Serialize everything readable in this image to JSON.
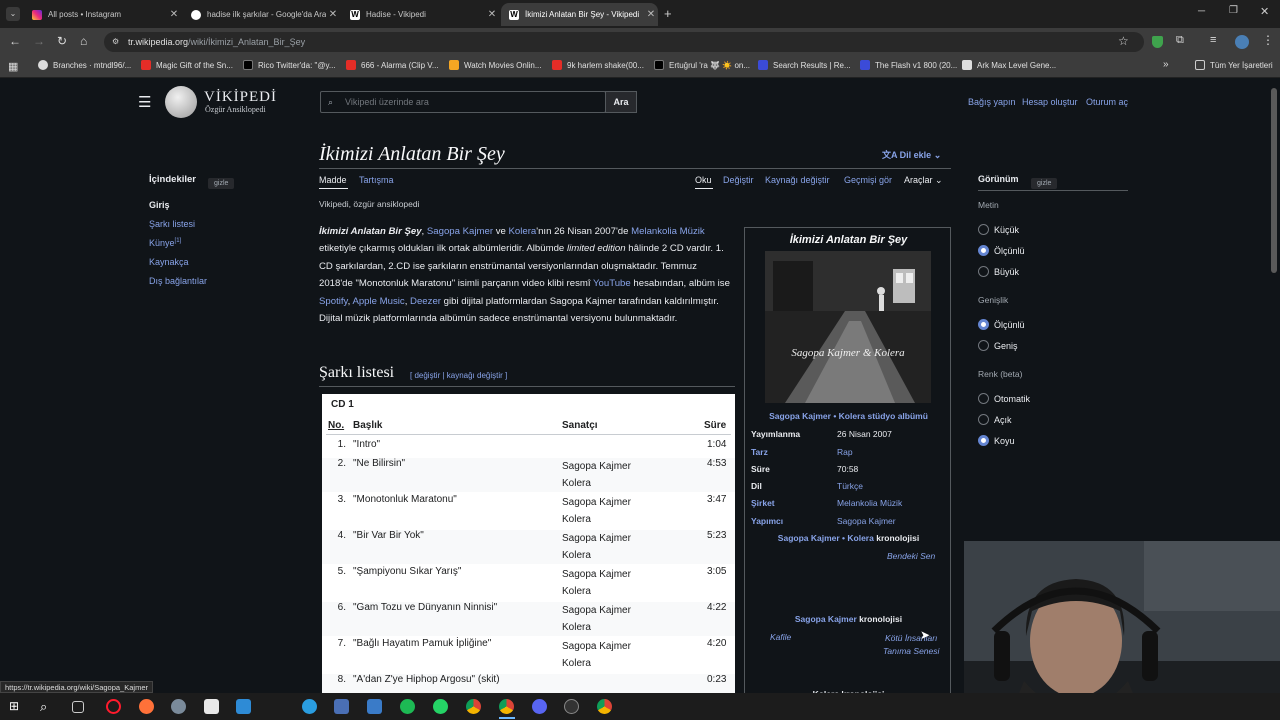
{
  "browser": {
    "tabs": [
      {
        "title": "All posts • Instagram",
        "active": false
      },
      {
        "title": "hadise ilk şarkılar - Google'da Ara",
        "active": false
      },
      {
        "title": "Hadise - Vikipedi",
        "active": false
      },
      {
        "title": "İkimizi Anlatan Bir Şey - Vikipedi",
        "active": true
      }
    ],
    "url_host": "tr.wikipedia.org",
    "url_path": "/wiki/İkimizi_Anlatan_Bir_Şey",
    "bookmarks": [
      "Branches · mtndl96/...",
      "Magic Gift of the Sn...",
      "Rico Twitter'da: \"@y...",
      "666 - Alarma (Clip V...",
      "Watch Movies Onlin...",
      "9k harlem shake(00...",
      "Ertuğrul 'ra 🐺 ☀️ on...",
      "Search Results | Re...",
      "The Flash v1 800 (20...",
      "Ark Max Level Gene..."
    ],
    "all_bookmarks": "Tüm Yer İşaretleri"
  },
  "header": {
    "logo_title": "VİKİPEDİ",
    "logo_subtitle": "Özgür Ansiklopedi",
    "search_placeholder": "Vikipedi üzerinde ara",
    "search_button": "Ara",
    "links": [
      "Bağış yapın",
      "Hesap oluştur",
      "Oturum aç"
    ]
  },
  "toc": {
    "title": "İçindekiler",
    "hide": "gizle",
    "items": [
      "Giriş",
      "Şarkı listesi",
      "Künye",
      "Kaynakça",
      "Dış bağlantılar"
    ],
    "kunye_sup": "[1]"
  },
  "article": {
    "title": "İkimizi Anlatan Bir Şey",
    "lang_button": "Dil ekle",
    "tabs_left": [
      "Madde",
      "Tartışma"
    ],
    "tabs_right": [
      "Oku",
      "Değiştir",
      "Kaynağı değiştir",
      "Geçmişi gör",
      "Araçlar"
    ],
    "tagline": "Vikipedi, özgür ansiklopedi",
    "intro": {
      "b_title": "İkimizi Anlatan Bir Şey",
      "p1": ", ",
      "l_sagopa": "Sagopa Kajmer",
      "p2": " ve ",
      "l_kolera": "Kolera",
      "p3": "'nın 26 Nisan 2007'de ",
      "l_label": "Melankolia Müzik",
      "p4": " etiketiyle çıkarmış oldukları ilk ortak albümleridir. Albümde ",
      "i_limited": "limited edition",
      "p5": " hâlinde 2 CD vardır. 1. CD şarkılardan, 2.CD ise şarkıların enstrümantal versiyonlarından oluşmaktadır. Temmuz 2018'de \"Monotonluk Maratonu\" isimli parçanın video klibi resmî ",
      "l_youtube": "YouTube",
      "p6": " hesabından, albüm ise ",
      "l_spotify": "Spotify",
      "p7": ", ",
      "l_apple": "Apple Music",
      "p8": ", ",
      "l_deezer": "Deezer",
      "p9": " gibi dijital platformlardan Sagopa Kajmer tarafından kaldırılmıştır. Dijital müzik platformlarında albümün sadece enstrümantal versiyonu bulunmaktadır."
    },
    "section": "Şarkı listesi",
    "section_edit": "[ değiştir | kaynağı değiştir ]"
  },
  "tracklist": {
    "cd": "CD 1",
    "headers": {
      "no": "No.",
      "title": "Başlık",
      "artist": "Sanatçı",
      "duration": "Süre"
    },
    "rows": [
      {
        "no": "1.",
        "title": "\"Intro\"",
        "a1": "",
        "a2": "",
        "dur": "1:04"
      },
      {
        "no": "2.",
        "title": "\"Ne Bilirsin\"",
        "a1": "Sagopa Kajmer",
        "a2": "Kolera",
        "dur": "4:53"
      },
      {
        "no": "3.",
        "title": "\"Monotonluk Maratonu\"",
        "a1": "Sagopa Kajmer",
        "a2": "Kolera",
        "dur": "3:47"
      },
      {
        "no": "4.",
        "title": "\"Bir Var Bir Yok\"",
        "a1": "Sagopa Kajmer",
        "a2": "Kolera",
        "dur": "5:23"
      },
      {
        "no": "5.",
        "title": "\"Şampiyonu Sıkar Yarış\"",
        "a1": "Sagopa Kajmer",
        "a2": "Kolera",
        "dur": "3:05"
      },
      {
        "no": "6.",
        "title": "\"Gam Tozu ve Dünyanın Ninnisi\"",
        "a1": "Sagopa Kajmer",
        "a2": "Kolera",
        "dur": "4:22"
      },
      {
        "no": "7.",
        "title": "\"Bağlı Hayatım Pamuk İpliğine\"",
        "a1": "Sagopa Kajmer",
        "a2": "Kolera",
        "dur": "4:20"
      },
      {
        "no": "8.",
        "title": "\"A'dan Z'ye Hiphop Argosu\" (skit)",
        "a1": "",
        "a2": "",
        "dur": "0:23"
      }
    ]
  },
  "infobox": {
    "title": "İkimizi Anlatan Bir Şey",
    "cover_text": "Sagopa Kajmer & Kolera",
    "subtitle_artist1": "Sagopa Kajmer",
    "subtitle_sep": " • ",
    "subtitle_artist2": "Kolera",
    "subtitle_rest": " stüdyo albümü",
    "rows": [
      {
        "label": "Yayımlanma",
        "value": "26 Nisan 2007",
        "label_link": false,
        "value_link": false
      },
      {
        "label": "Tarz",
        "value": "Rap",
        "label_link": true,
        "value_link": true
      },
      {
        "label": "Süre",
        "value": "70:58",
        "label_link": false,
        "value_link": false
      },
      {
        "label": "Dil",
        "value": "Türkçe",
        "label_link": false,
        "value_link": true
      },
      {
        "label": "Şirket",
        "value": "Melankolia Müzik",
        "label_link": true,
        "value_link": true
      },
      {
        "label": "Yapımcı",
        "value": "Sagopa Kajmer",
        "label_link": true,
        "value_link": true
      }
    ],
    "chrono1": {
      "a1": "Sagopa Kajmer",
      "a2": "Kolera",
      "suffix": " kronolojisi",
      "next": "Bendeki Sen"
    },
    "chrono2": {
      "a1": "Sagopa Kajmer",
      "suffix": " kronolojisi",
      "prev": "Kafile",
      "next1": "Kötü İnsanları",
      "next2": "Tanıma Senesi"
    },
    "chrono3": "Kolera kronolojisi"
  },
  "appearance": {
    "title": "Görünüm",
    "hide": "gizle",
    "text_label": "Metin",
    "text_opts": [
      {
        "label": "Küçük",
        "on": false
      },
      {
        "label": "Ölçünlü",
        "on": true
      },
      {
        "label": "Büyük",
        "on": false
      }
    ],
    "width_label": "Genişlik",
    "width_opts": [
      {
        "label": "Ölçünlü",
        "on": true
      },
      {
        "label": "Geniş",
        "on": false
      }
    ],
    "color_label": "Renk (beta)",
    "color_opts": [
      {
        "label": "Otomatik",
        "on": false
      },
      {
        "label": "Açık",
        "on": false
      },
      {
        "label": "Koyu",
        "on": true
      }
    ]
  },
  "status_url": "https://tr.wikipedia.org/wiki/Sagopa_Kajmer",
  "colors": {
    "link": "#88a3e8",
    "bg": "#101418",
    "accent": "#6485d1"
  }
}
